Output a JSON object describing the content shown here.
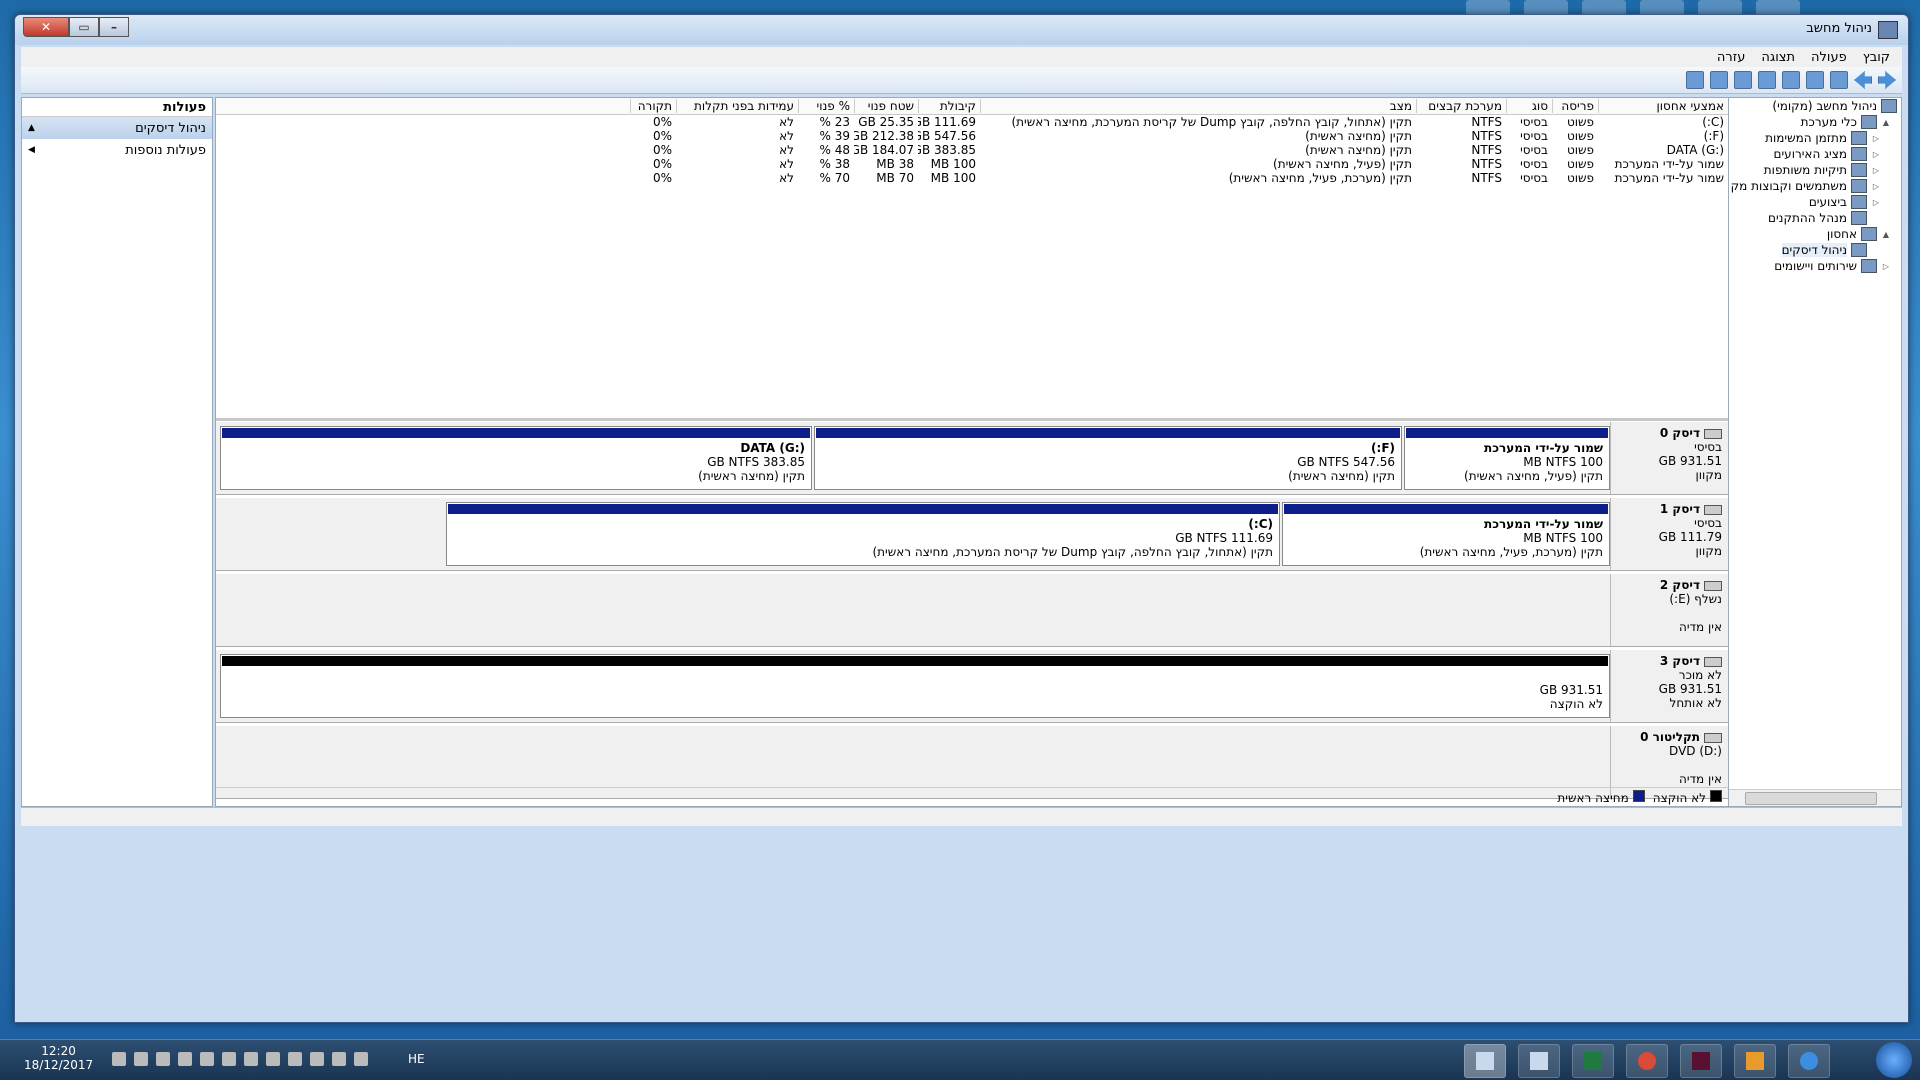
{
  "window": {
    "title": "ניהול מחשב",
    "close_glyph": "✕",
    "restore_glyph": "▭",
    "min_glyph": "–"
  },
  "menu": [
    "קובץ",
    "פעולה",
    "תצוגה",
    "עזרה"
  ],
  "tree": {
    "root": "ניהול מחשב (מקומי)",
    "items": [
      {
        "label": "כלי מערכת",
        "icon": "tools-icon",
        "expand": "▲",
        "level": 1
      },
      {
        "label": "מתזמן המשימות",
        "icon": "clock-icon",
        "expand": "▷",
        "level": 2
      },
      {
        "label": "מציג האירועים",
        "icon": "event-viewer-icon",
        "expand": "▷",
        "level": 2
      },
      {
        "label": "תיקיות משותפות",
        "icon": "shared-folder-icon",
        "expand": "▷",
        "level": 2
      },
      {
        "label": "משתמשים וקבוצות מק",
        "icon": "users-icon",
        "expand": "▷",
        "level": 2
      },
      {
        "label": "ביצועים",
        "icon": "performance-icon",
        "expand": "▷",
        "level": 2
      },
      {
        "label": "מנהל ההתקנים",
        "icon": "device-manager-icon",
        "expand": "",
        "level": 2
      },
      {
        "label": "אחסון",
        "icon": "storage-icon",
        "expand": "▲",
        "level": 1
      },
      {
        "label": "ניהול דיסקים",
        "icon": "disk-management-icon",
        "expand": "",
        "level": 2,
        "selected": true
      },
      {
        "label": "שירותים ויישומים",
        "icon": "services-icon",
        "expand": "▷",
        "level": 1
      }
    ]
  },
  "actions": {
    "header": "פעולות",
    "items": [
      {
        "label": "ניהול דיסקים",
        "arrow": "▲",
        "highlight": true
      },
      {
        "label": "פעולות נוספות",
        "arrow": "◀",
        "highlight": false
      }
    ]
  },
  "volume_table": {
    "headers": [
      "אמצעי אחסון",
      "פריסה",
      "סוג",
      "מערכת קבצים",
      "מצב",
      "קיבולת",
      "שטח פנוי",
      "% פנוי",
      "עמידות בפני תקלות",
      "תקורה"
    ],
    "rows": [
      [
        "(C:)",
        "פשוט",
        "בסיסי",
        "NTFS",
        "תקין (אתחול, קובץ החלפה, קובץ Dump של קריסת המערכת, מחיצה ראשית)",
        "111.69 GB",
        "25.35 GB",
        "23 %",
        "לא",
        "0%"
      ],
      [
        "(F:)",
        "פשוט",
        "בסיסי",
        "NTFS",
        "תקין (מחיצה ראשית)",
        "547.56 GB",
        "212.38 GB",
        "39 %",
        "לא",
        "0%"
      ],
      [
        "DATA (G:)",
        "פשוט",
        "בסיסי",
        "NTFS",
        "תקין (מחיצה ראשית)",
        "383.85 GB",
        "184.07 GB",
        "48 %",
        "לא",
        "0%"
      ],
      [
        "שמור על-ידי המערכת",
        "פשוט",
        "בסיסי",
        "NTFS",
        "תקין (פעיל, מחיצה ראשית)",
        "100 MB",
        "38 MB",
        "38 %",
        "לא",
        "0%"
      ],
      [
        "שמור על-ידי המערכת",
        "פשוט",
        "בסיסי",
        "NTFS",
        "תקין (מערכת, פעיל, מחיצה ראשית)",
        "100 MB",
        "70 MB",
        "70 %",
        "לא",
        "0%"
      ]
    ]
  },
  "disks": [
    {
      "name": "דיסק 0",
      "type": "בסיסי",
      "size": "931.51 GB",
      "status": "מקוון",
      "partitions": [
        {
          "title": "שמור על-ידי המערכת",
          "line2": "100 MB NTFS",
          "line3": "תקין (פעיל, מחיצה ראשית)"
        },
        {
          "title": "(F:)",
          "line2": "547.56 GB NTFS",
          "line3": "תקין (מחיצה ראשית)"
        },
        {
          "title": "DATA  (G:)",
          "line2": "383.85 GB NTFS",
          "line3": "תקין (מחיצה ראשית)"
        }
      ]
    },
    {
      "name": "דיסק 1",
      "type": "בסיסי",
      "size": "111.79 GB",
      "status": "מקוון",
      "partitions": [
        {
          "title": "שמור על-ידי המערכת",
          "line2": "100 MB NTFS",
          "line3": "תקין (מערכת, פעיל, מחיצה ראשית)"
        },
        {
          "title": "(C:)",
          "line2": "111.69 GB NTFS",
          "line3": "תקין (אתחול, קובץ החלפה, קובץ Dump של קריסת המערכת, מחיצה ראשית)"
        }
      ]
    },
    {
      "name": "דיסק 2",
      "type": "נשלף (E:)",
      "size": "",
      "status": "אין מדיה"
    },
    {
      "name": "דיסק 3",
      "type": "לא מוכר",
      "size": "931.51 GB",
      "status": "לא אותחל",
      "partitions": [
        {
          "title": "",
          "line2": "931.51 GB",
          "line3": "לא הוקצה"
        }
      ]
    },
    {
      "name": "תקליטור 0",
      "type": "DVD (D:)",
      "size": "",
      "status": "אין מדיה"
    }
  ],
  "legend": [
    {
      "label": "לא הוקצה",
      "color": "#000000"
    },
    {
      "label": "מחיצה ראשית",
      "color": "#0d1e8a"
    }
  ],
  "taskbar": {
    "time": "12:20",
    "date": "18/12/2017",
    "lang": "HE"
  }
}
